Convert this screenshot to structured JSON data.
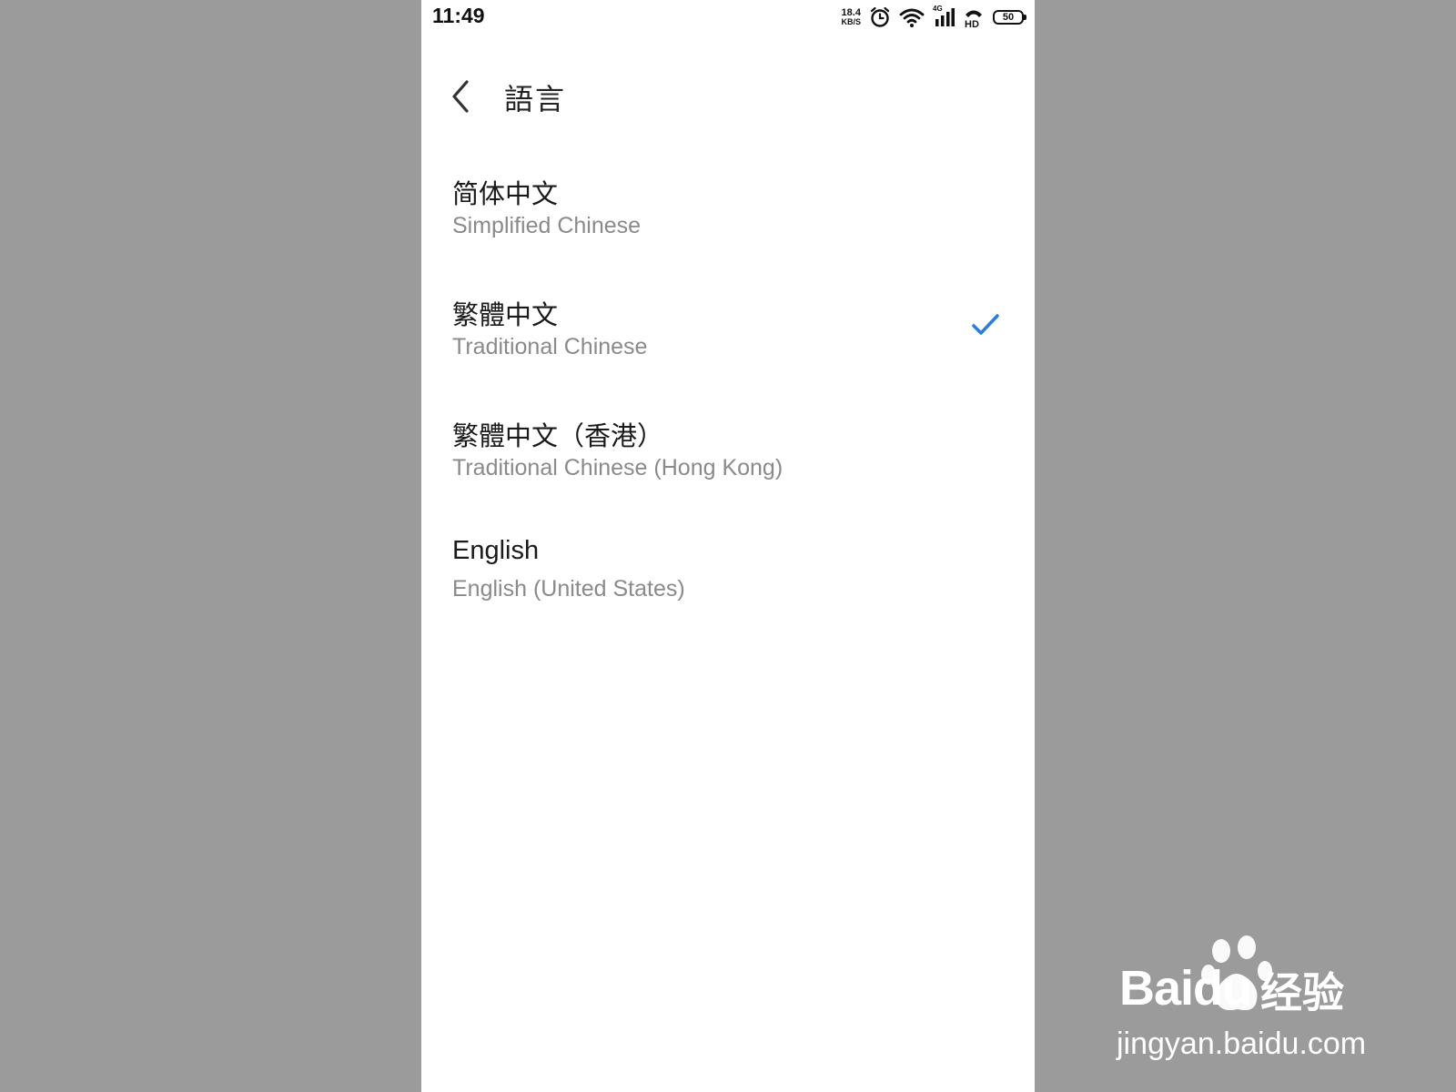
{
  "status_bar": {
    "time": "11:49",
    "net_speed_value": "18.4",
    "net_speed_unit": "KB/S",
    "network_type": "4G",
    "battery": "50"
  },
  "header": {
    "title": "語言"
  },
  "languages": [
    {
      "primary": "简体中文",
      "secondary": "Simplified Chinese",
      "selected": false
    },
    {
      "primary": "繁體中文",
      "secondary": "Traditional Chinese",
      "selected": true
    },
    {
      "primary": "繁體中文（香港）",
      "secondary": "Traditional Chinese (Hong Kong)",
      "selected": false
    },
    {
      "primary": "English",
      "secondary": "English (United States)",
      "selected": false
    }
  ],
  "watermark": {
    "brand": "Baidu",
    "product": "经验",
    "url": "jingyan.baidu.com"
  },
  "colors": {
    "accent": "#2d7de0",
    "primary_text": "#1a1a1a",
    "secondary_text": "#8a8a8a",
    "backdrop": "#9b9b9b"
  },
  "icons": [
    "back-arrow-icon",
    "check-icon",
    "alarm-icon",
    "wifi-icon",
    "signal-icon",
    "hd-call-icon",
    "battery-icon"
  ]
}
